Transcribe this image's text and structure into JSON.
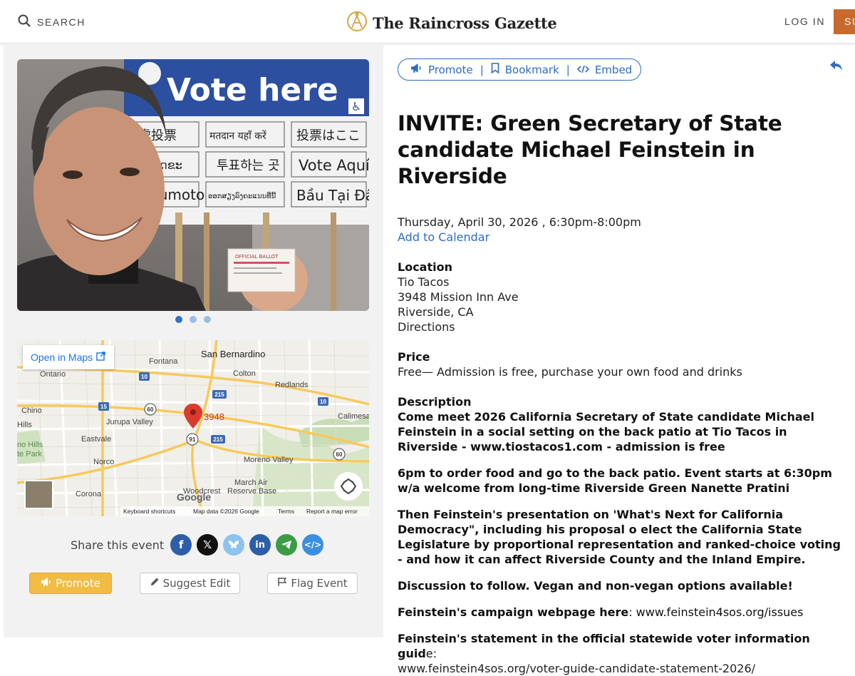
{
  "header": {
    "search_label": "SEARCH",
    "brand_name": "The Raincross Gazette",
    "login_label": "LOG IN",
    "subscribe_label": "SU"
  },
  "photo": {
    "sign_lines": [
      "Vote here",
      "處投票",
      "मतदान यहाँ करें",
      "投票はここ",
      "ໜາດຂະ",
      "투표하는 곳",
      "Vote Aquí",
      "Bumoto",
      "ອອກສຽງລົງຄະແນນທີ່ນີ້",
      "Bầu Tại Đây"
    ],
    "ballot_text": "OFFICIAL BALLOT"
  },
  "carousel": {
    "count": 3,
    "active": 0
  },
  "map": {
    "open_label": "Open in Maps",
    "marker_label": "3948",
    "places": [
      "Fontana",
      "San Bernardino",
      "Ontario",
      "Colton",
      "Redlands",
      "Chino",
      "Jurupa Valley",
      "Calimesa",
      "Hills",
      "Eastvale",
      "no Hills",
      "te Park",
      "Norco",
      "Moreno Valley",
      "March Air",
      "Reserve Base",
      "Corona",
      "Woodcrest"
    ],
    "highways": [
      "10",
      "215",
      "15",
      "60",
      "10",
      "91",
      "215",
      "60"
    ],
    "google_label": "Google",
    "footer": [
      "Keyboard shortcuts",
      "Map data ©2026 Google",
      "Terms",
      "Report a map error"
    ]
  },
  "share": {
    "label": "Share this event"
  },
  "actions": {
    "promote": "Promote",
    "suggest": "Suggest Edit",
    "flag": "Flag Event"
  },
  "toolbar": {
    "promote": "Promote",
    "bookmark": "Bookmark",
    "embed": "Embed"
  },
  "event": {
    "title": "INVITE: Green Secretary of State candidate Michael Feinstein in Riverside",
    "datetime": "Thursday, April 30, 2026 , 6:30pm-8:00pm",
    "add_calendar": "Add to Calendar",
    "location_heading": "Location",
    "venue": "Tio Tacos",
    "address1": "3948 Mission Inn Ave",
    "address2": "Riverside, CA",
    "directions": "Directions",
    "price_heading": "Price",
    "price": "Free— Admission is free, purchase your own food and drinks",
    "description_heading": "Description",
    "p1": "Come meet 2026 California Secretary of State candidate Michael Feinstein in a social setting on the back patio at Tio Tacos in Riverside - www.tiostacos1.com - admission is free",
    "p2": "6pm to order food and go to the back patio. Event starts at 6:30pm w/a welcome from long-time Riverside Green Nanette Pratini",
    "p3": "Then Feinstein's presentation on 'What's Next for California Democracy\", including his proposal o elect the California State Legislature by proportional representation and ranked-choice voting - and how it can affect Riverside County and the Inland Empire.",
    "p4": "Discussion to follow. Vegan and non-vegan options available!",
    "p5_bold": "Feinstein's campaign webpage here",
    "p5_rest": ": www.feinstein4sos.org/issues",
    "p6_bold": "Feinstein's statement in the official statewide voter information guid",
    "p6_rest": "e:",
    "p6_url": "www.feinstein4sos.org/voter-guide-candidate-statement-2026/"
  },
  "colors": {
    "accent": "#2d6cc0",
    "promote": "#f1bc44",
    "subscribe": "#c8692e"
  }
}
